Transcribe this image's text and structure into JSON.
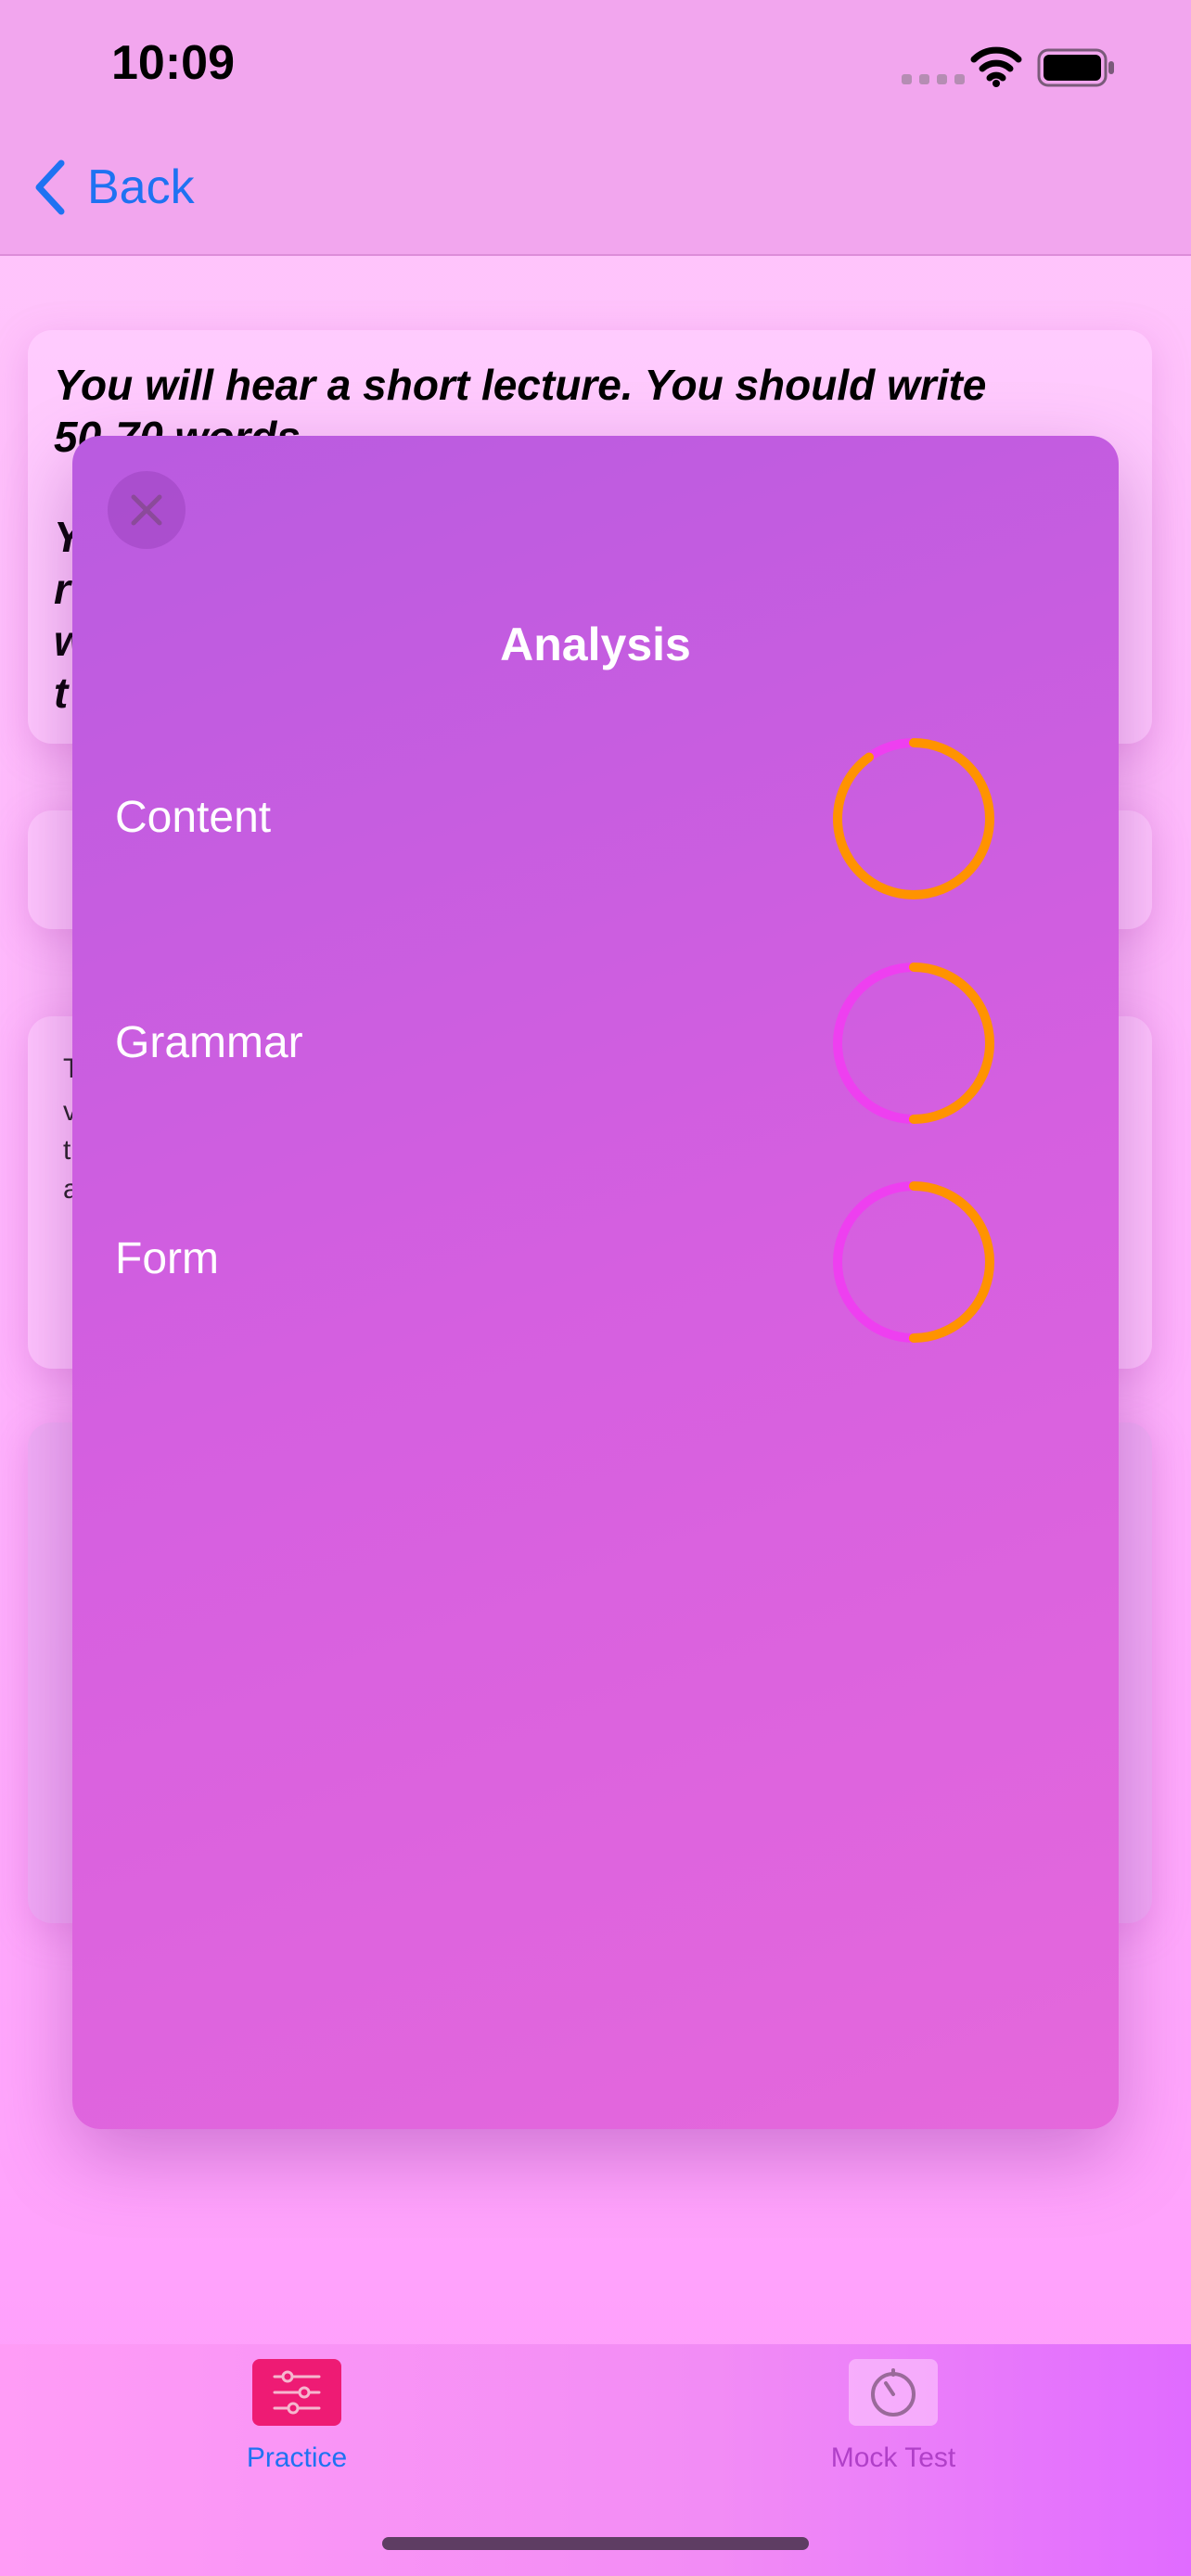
{
  "status_bar": {
    "time": "10:09"
  },
  "nav": {
    "back_label": "Back"
  },
  "background_card": {
    "line1": "You will hear a short lecture. You should write",
    "line2": "50-70 words",
    "left_fragments": [
      "Y",
      "r",
      "w",
      "t"
    ],
    "card3_fragments": [
      "T",
      "v",
      "t",
      "a"
    ]
  },
  "modal": {
    "title": "Analysis",
    "metrics": [
      {
        "label": "Content",
        "progress": 0.9
      },
      {
        "label": "Grammar",
        "progress": 0.5
      },
      {
        "label": "Form",
        "progress": 0.5
      }
    ]
  },
  "tabbar": {
    "tabs": [
      {
        "label": "Practice",
        "icon": "sliders-icon",
        "selected": true
      },
      {
        "label": "Mock Test",
        "icon": "timer-icon",
        "selected": false
      }
    ]
  },
  "colors": {
    "ring_track": "#ee3ff0",
    "ring_progress": "#ff9300",
    "accent_blue": "#1f72f2"
  }
}
